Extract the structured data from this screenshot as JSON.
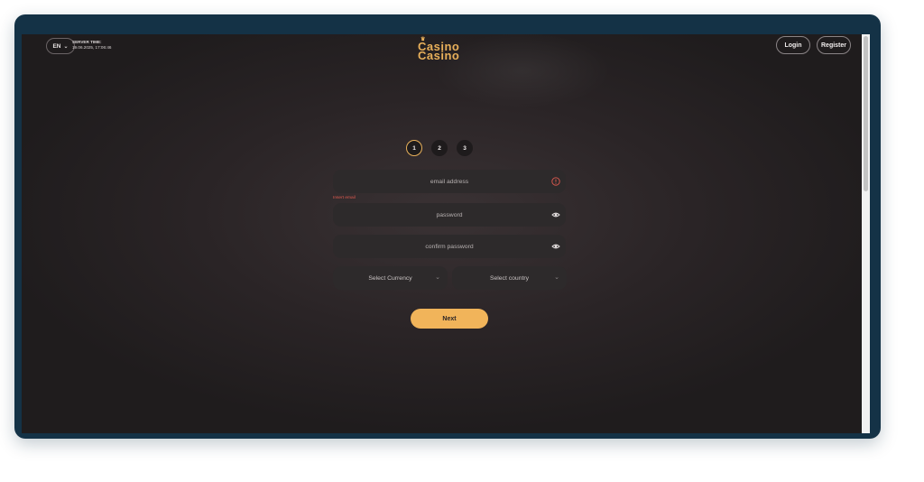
{
  "header": {
    "language": "EN",
    "server_time_label": "SERVER TIME:",
    "server_time_value": "19.06.2025, 17:06:46",
    "logo_line1": "Casino",
    "logo_line2": "Casino",
    "login_label": "Login",
    "register_label": "Register"
  },
  "steps": [
    "1",
    "2",
    "3"
  ],
  "form": {
    "email_value": "email address",
    "email_error": "Insert email",
    "password_placeholder": "password",
    "confirm_placeholder": "confirm password",
    "currency_label": "Select Currency",
    "country_label": "Select country",
    "next_label": "Next"
  },
  "colors": {
    "accent": "#f1b45a",
    "error": "#e05a4f",
    "frame": "#143246"
  },
  "icons": {
    "email_status": "alert-circle-icon",
    "password_toggle": "eye-icon",
    "confirm_toggle": "eye-icon",
    "dropdown": "chevron-down-icon",
    "logo": "crown-icon"
  }
}
